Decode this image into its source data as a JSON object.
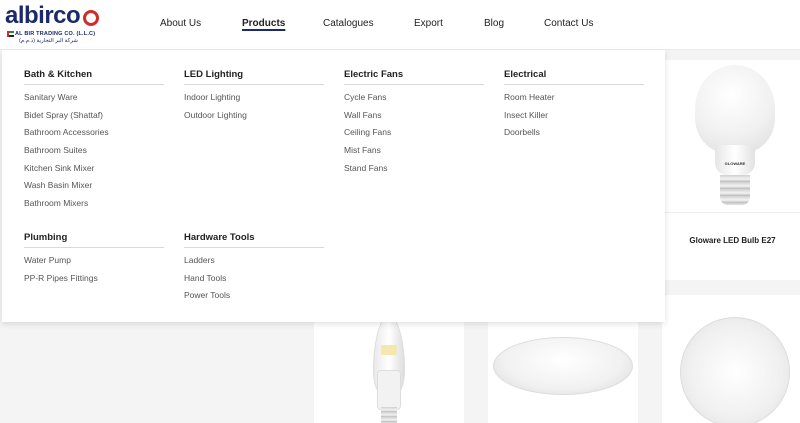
{
  "brand": {
    "name": "albirco",
    "subtitle": "AL BIR TRADING CO. (L.L.C)",
    "arabic": "شركة البر التجارية (ذ.م.م)",
    "primary_color": "#1b2a6b",
    "accent_color": "#d22a2a"
  },
  "nav": {
    "items": [
      "About Us",
      "Products",
      "Catalogues",
      "Export",
      "Blog",
      "Contact Us"
    ],
    "active": "Products"
  },
  "menu": {
    "columns": [
      {
        "heading": "Bath & Kitchen",
        "links": [
          "Sanitary Ware",
          "Bidet Spray (Shattaf)",
          "Bathroom Accessories",
          "Bathroom Suites",
          "Kitchen Sink Mixer",
          "Wash Basin Mixer",
          "Bathroom Mixers"
        ]
      },
      {
        "heading": "LED Lighting",
        "links": [
          "Indoor Lighting",
          "Outdoor Lighting"
        ]
      },
      {
        "heading": "Electric Fans",
        "links": [
          "Cycle Fans",
          "Wall Fans",
          "Ceiling Fans",
          "Mist Fans",
          "Stand Fans"
        ]
      },
      {
        "heading": "Electrical",
        "links": [
          "Room Heater",
          "Insect Killer",
          "Doorbells"
        ]
      },
      {
        "heading": "Plumbing",
        "links": [
          "Water Pump",
          "PP-R Pipes Fittings"
        ]
      },
      {
        "heading": "Hardware Tools",
        "links": [
          "Ladders",
          "Hand Tools",
          "Power Tools"
        ]
      }
    ]
  },
  "products": {
    "featured_title": "Gloware LED Bulb E27",
    "bulb_brand": "GLOWARE"
  }
}
